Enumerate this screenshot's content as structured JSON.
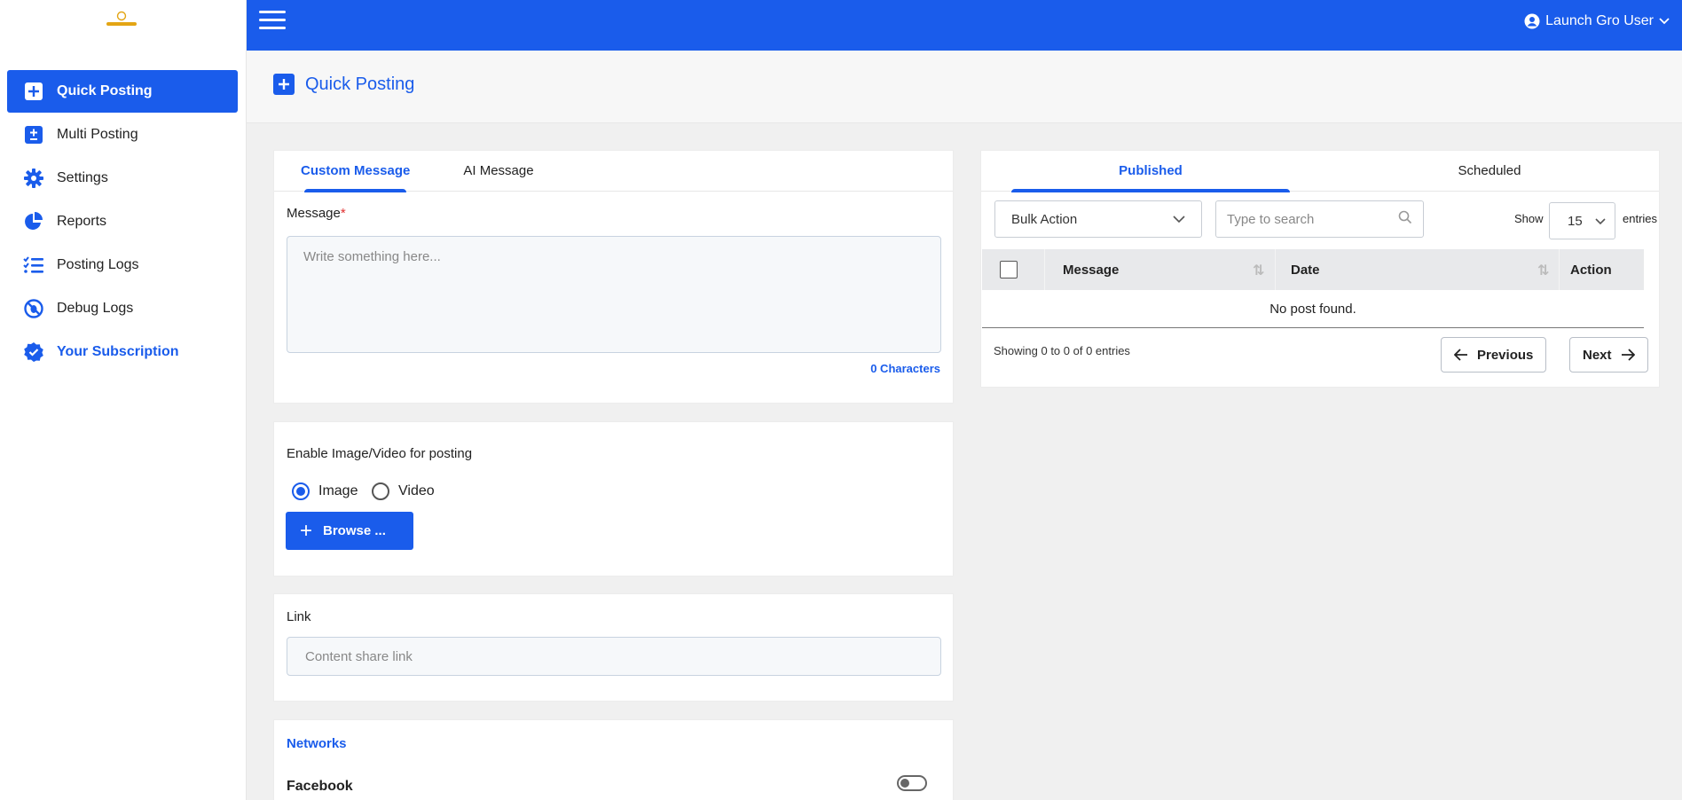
{
  "app": {
    "user_name": "Launch Gro User"
  },
  "sidebar": {
    "items": [
      {
        "label": "Quick Posting",
        "icon": "plus-square-icon"
      },
      {
        "label": "Multi Posting",
        "icon": "plus-minus-icon"
      },
      {
        "label": "Settings",
        "icon": "gear-icon"
      },
      {
        "label": "Reports",
        "icon": "pie-chart-icon"
      },
      {
        "label": "Posting Logs",
        "icon": "checklist-icon"
      },
      {
        "label": "Debug Logs",
        "icon": "bug-icon"
      },
      {
        "label": "Your Subscription",
        "icon": "badge-check-icon"
      }
    ]
  },
  "page": {
    "title": "Quick Posting"
  },
  "composer": {
    "tabs": [
      "Custom Message",
      "AI Message"
    ],
    "message_label": "Message",
    "required_mark": "*",
    "message_placeholder": "Write something here...",
    "char_count": "0 Characters",
    "media_label": "Enable Image/Video for posting",
    "media_options": [
      "Image",
      "Video"
    ],
    "browse_label": "Browse ...",
    "link_label": "Link",
    "link_placeholder": "Content share link",
    "networks_title": "Networks",
    "networks": [
      {
        "name": "Facebook"
      }
    ]
  },
  "posts": {
    "tabs": [
      "Published",
      "Scheduled"
    ],
    "bulk_action": "Bulk Action",
    "search_placeholder": "Type to search",
    "show_label": "Show",
    "page_size": "15",
    "entries_label": "entries",
    "columns": [
      "Message",
      "Date",
      "Action"
    ],
    "empty_text": "No post found.",
    "showing_text": "Showing 0 to 0 of 0 entries",
    "prev_label": "Previous",
    "next_label": "Next"
  },
  "colors": {
    "primary": "#1a5ceb",
    "logo_accent": "#e3a514"
  }
}
